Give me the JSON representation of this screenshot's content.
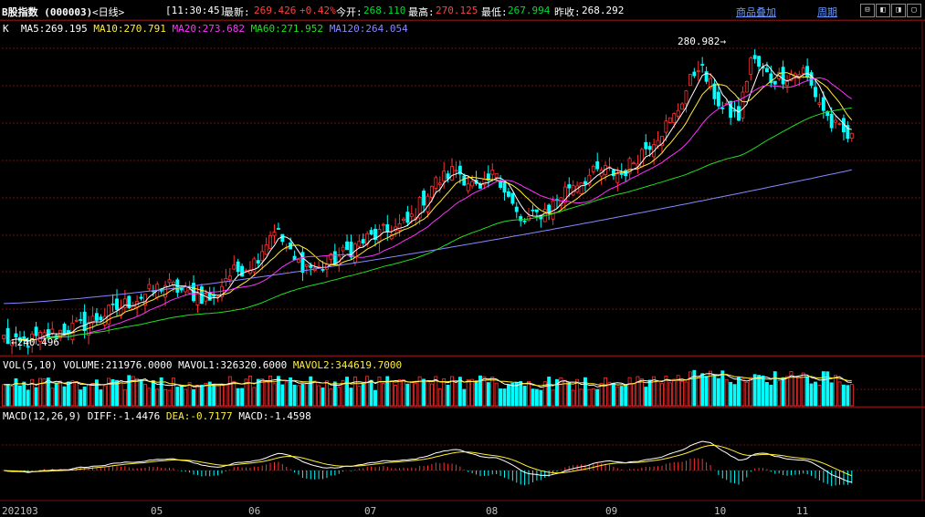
{
  "header": {
    "name": "B股指数 (000003)",
    "period": "<日线>",
    "time": "[11:30:45]",
    "latest_label": "最新:",
    "latest_value": "269.426",
    "change": "+0.42%",
    "open_label": "今开:",
    "open_value": "268.110",
    "high_label": "最高:",
    "high_value": "270.125",
    "low_label": "最低:",
    "low_value": "267.994",
    "prev_label": "昨收:",
    "prev_value": "268.292",
    "overlay_link": "商品叠加",
    "period_link": "周期"
  },
  "toolbar": {
    "buttons": [
      "⊟",
      "◧",
      "◨",
      "▢"
    ]
  },
  "price_panel": {
    "k_label": "K",
    "ma5": "MA5:269.195",
    "ma10": "MA10:270.791",
    "ma20": "MA20:273.682",
    "ma60": "MA60:271.952",
    "ma120": "MA120:264.054",
    "high_marker": "280.982",
    "low_marker": "240.496"
  },
  "volume_panel": {
    "label": "VOL(5,10)",
    "volume": "VOLUME:211976.0000",
    "mavol1": "MAVOL1:326320.6000",
    "mavol2": "MAVOL2:344619.7000"
  },
  "macd_panel": {
    "label": "MACD(12,26,9)",
    "diff": "DIFF:-1.4476",
    "dea": "DEA:-0.7177",
    "macd": "MACD:-1.4598"
  },
  "x_axis": {
    "labels": [
      "202103",
      "05",
      "06",
      "07",
      "08",
      "09",
      "10",
      "11"
    ]
  },
  "colors": {
    "up": "#ff3030",
    "down": "#00ffff",
    "ma5": "#ffffff",
    "ma10": "#ffee33",
    "ma20": "#ff33ff",
    "ma60": "#20e020",
    "ma120": "#8888ff",
    "grid": "#6e1010"
  },
  "chart_data": {
    "type": "candlestick",
    "price_max": 280.982,
    "price_min": 240.496,
    "keypoints": [
      [
        0,
        242
      ],
      [
        3,
        241
      ],
      [
        20,
        243.8
      ],
      [
        40,
        249
      ],
      [
        45,
        248
      ],
      [
        52,
        247
      ],
      [
        55,
        250
      ],
      [
        62,
        252
      ],
      [
        67,
        256.5
      ],
      [
        72,
        252
      ],
      [
        78,
        251
      ],
      [
        90,
        255
      ],
      [
        100,
        257
      ],
      [
        106,
        262
      ],
      [
        112,
        264.2
      ],
      [
        118,
        261
      ],
      [
        122,
        264
      ],
      [
        128,
        257
      ],
      [
        135,
        259
      ],
      [
        140,
        262
      ],
      [
        148,
        264
      ],
      [
        153,
        263.5
      ],
      [
        158,
        266.5
      ],
      [
        166,
        271
      ],
      [
        172,
        278
      ],
      [
        178,
        272
      ],
      [
        182,
        271
      ],
      [
        185,
        278.7
      ],
      [
        190,
        276
      ],
      [
        198,
        277
      ],
      [
        205,
        270
      ],
      [
        210,
        268
      ]
    ],
    "ma120_range": [
      246.5,
      264.054
    ]
  }
}
